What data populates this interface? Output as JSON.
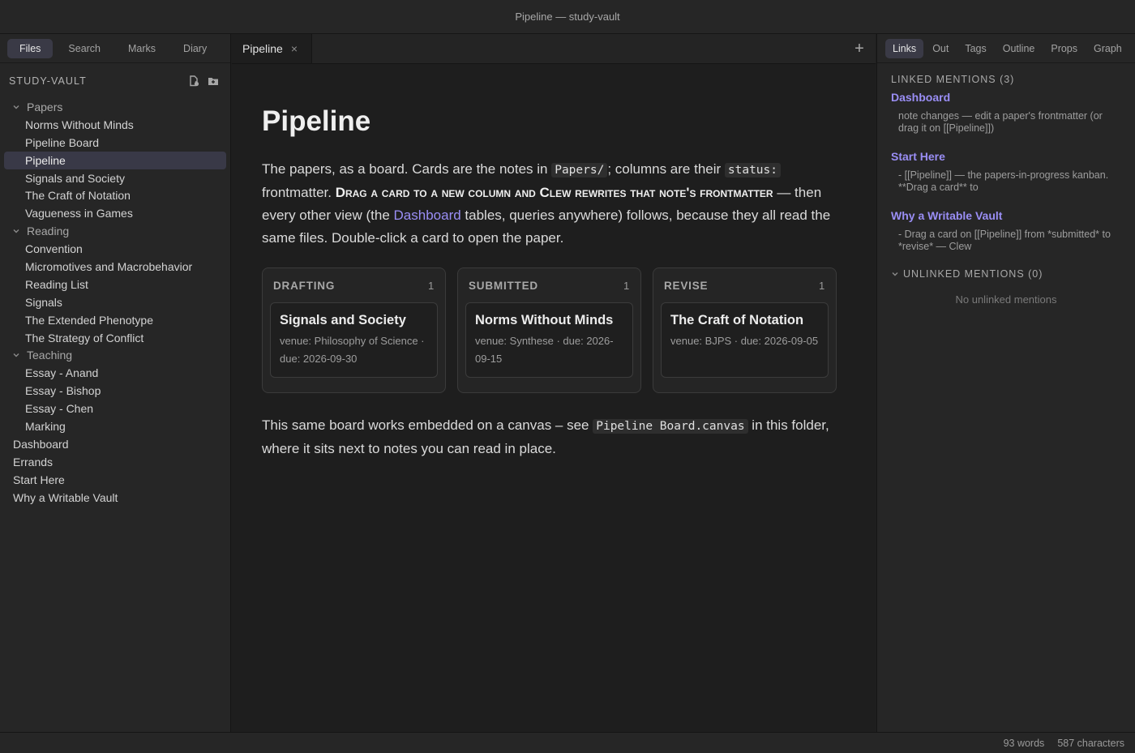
{
  "window": {
    "title": "Pipeline — study-vault"
  },
  "sidebar": {
    "tabs": [
      "Files",
      "Search",
      "Marks",
      "Diary"
    ],
    "vault_name": "STUDY-VAULT",
    "tree": [
      {
        "kind": "folder",
        "label": "Papers"
      },
      {
        "kind": "child",
        "label": "Norms Without Minds"
      },
      {
        "kind": "child",
        "label": "Pipeline Board"
      },
      {
        "kind": "child",
        "label": "Pipeline",
        "active": true
      },
      {
        "kind": "child",
        "label": "Signals and Society"
      },
      {
        "kind": "child",
        "label": "The Craft of Notation"
      },
      {
        "kind": "child",
        "label": "Vagueness in Games"
      },
      {
        "kind": "folder",
        "label": "Reading"
      },
      {
        "kind": "child",
        "label": "Convention"
      },
      {
        "kind": "child",
        "label": "Micromotives and Macrobehavior"
      },
      {
        "kind": "child",
        "label": "Reading List"
      },
      {
        "kind": "child",
        "label": "Signals"
      },
      {
        "kind": "child",
        "label": "The Extended Phenotype"
      },
      {
        "kind": "child",
        "label": "The Strategy of Conflict"
      },
      {
        "kind": "folder",
        "label": "Teaching"
      },
      {
        "kind": "child",
        "label": "Essay - Anand"
      },
      {
        "kind": "child",
        "label": "Essay - Bishop"
      },
      {
        "kind": "child",
        "label": "Essay - Chen"
      },
      {
        "kind": "child",
        "label": "Marking"
      },
      {
        "kind": "root",
        "label": "Dashboard"
      },
      {
        "kind": "root",
        "label": "Errands"
      },
      {
        "kind": "root",
        "label": "Start Here"
      },
      {
        "kind": "root",
        "label": "Why a Writable Vault"
      }
    ]
  },
  "editor": {
    "tab_label": "Pipeline",
    "close_glyph": "×",
    "new_tab_glyph": "+",
    "title": "Pipeline",
    "para1": {
      "t1": "The papers, as a board. Cards are the notes in ",
      "code1": "Papers/",
      "t2": "; columns are their ",
      "code2": "status:",
      "t3": " frontmatter. ",
      "bold": "Drag a card to a new column and Clew rewrites that note's frontmatter",
      "t4": " — then every other view (the ",
      "link": "Dashboard",
      "t5": " tables, queries anywhere) follows, because they all read the same files. Double-click a card to open the paper."
    },
    "board": [
      {
        "name": "DRAFTING",
        "count": "1",
        "card_title": "Signals and Society",
        "card_meta": "venue: Philosophy of Science · due: 2026-09-30"
      },
      {
        "name": "SUBMITTED",
        "count": "1",
        "card_title": "Norms Without Minds",
        "card_meta": "venue: Synthese · due: 2026-09-15"
      },
      {
        "name": "REVISE",
        "count": "1",
        "card_title": "The Craft of Notation",
        "card_meta": "venue: BJPS · due: 2026-09-05"
      }
    ],
    "para2": {
      "t1": "This same board works embedded on a canvas – see ",
      "code": "Pipeline Board.canvas",
      "t2": " in this folder, where it sits next to notes you can read in place."
    }
  },
  "right_panel": {
    "tabs": [
      "Links",
      "Out",
      "Tags",
      "Outline",
      "Props",
      "Graph"
    ],
    "linked_head": "LINKED MENTIONS (3)",
    "mentions": [
      {
        "title": "Dashboard",
        "snippet": "note changes — edit a paper's frontmatter (or drag it on [[Pipeline]])"
      },
      {
        "title": "Start Here",
        "snippet": "- [[Pipeline]] — the papers-in-progress kanban. **Drag a card** to"
      },
      {
        "title": "Why a Writable Vault",
        "snippet": "- Drag a card on [[Pipeline]] from *submitted* to *revise* — Clew"
      }
    ],
    "unlinked_head": "UNLINKED MENTIONS (0)",
    "no_unlinked": "No unlinked mentions"
  },
  "status": {
    "words": "93 words",
    "chars": "587 characters"
  },
  "colors": {
    "accent": "#9a8ef5",
    "active_bg": "#3a3a46",
    "background": "#1e1e1e",
    "panel": "#262626"
  }
}
